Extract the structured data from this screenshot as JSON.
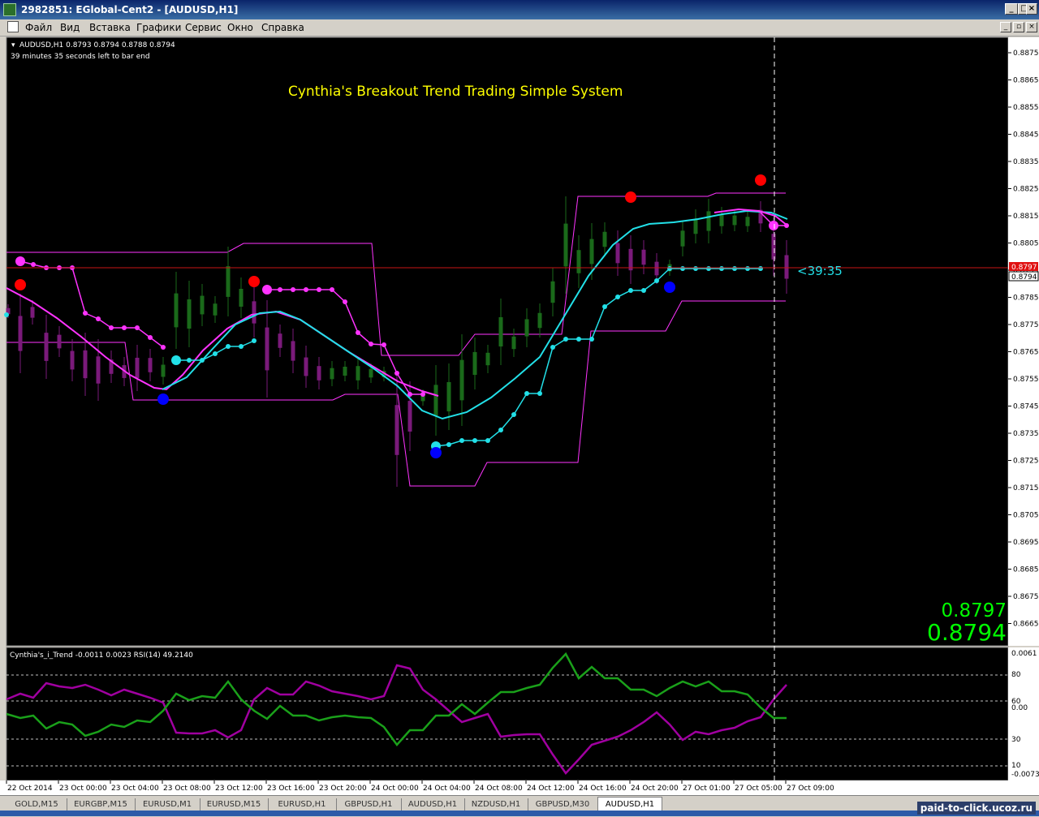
{
  "window": {
    "title": "2982851: EGlobal-Cent2 - [AUDUSD,H1]"
  },
  "menu": [
    "Файл",
    "Вид",
    "Вставка",
    "Графики",
    "Сервис",
    "Окно",
    "Справка"
  ],
  "chart": {
    "header": "AUDUSD,H1  0.8793 0.8794 0.8788 0.8794",
    "timer_text": "39 minutes 35 seconds left to bar end",
    "system_title": "Cynthia's Breakout Trend Trading Simple System",
    "countdown": "<39:35",
    "ask_tag": "0.8797",
    "bid_tag": "0.8794",
    "big_ask": "0.8797",
    "big_bid": "0.8794",
    "indicator_label": "Cynthia's_i_Trend -0.0011 0.0023  RSI(14) 49.2140",
    "price_scale": [
      "0.8875",
      "0.8865",
      "0.8855",
      "0.8845",
      "0.8835",
      "0.8825",
      "0.8815",
      "0.8805",
      "0.8795",
      "0.8785",
      "0.8775",
      "0.8765",
      "0.8755",
      "0.8745",
      "0.8735",
      "0.8725",
      "0.8715",
      "0.8705",
      "0.8695",
      "0.8685",
      "0.8675",
      "0.8665"
    ],
    "indicator_scale": [
      "0.0061",
      "80",
      "60",
      "0.00",
      "30",
      "10",
      "-0.0073"
    ],
    "time_labels": [
      "22 Oct 2014",
      "23 Oct 00:00",
      "23 Oct 04:00",
      "23 Oct 08:00",
      "23 Oct 12:00",
      "23 Oct 16:00",
      "23 Oct 20:00",
      "24 Oct 00:00",
      "24 Oct 04:00",
      "24 Oct 08:00",
      "24 Oct 12:00",
      "24 Oct 16:00",
      "24 Oct 20:00",
      "27 Oct 01:00",
      "27 Oct 05:00",
      "27 Oct 09:00"
    ],
    "colors": {
      "background": "#000000",
      "bull": "#1a6a1a",
      "bear": "#7a1a7a",
      "cyan": "#22e0e8",
      "magenta": "#ff33ff",
      "red_dot": "#ff0000",
      "blue_dot": "#0000ff",
      "title": "#ffff00",
      "big_price": "#00ff00",
      "rsi": "#a000a0",
      "trend": "#1aa01a"
    }
  },
  "tabs": [
    "GOLD,M15",
    "EURGBP,M15",
    "EURUSD,M1",
    "EURUSD,M15",
    "EURUSD,H1",
    "GBPUSD,H1",
    "AUDUSD,H1",
    "NZDUSD,H1",
    "GBPUSD,M30",
    "AUDUSD,H1"
  ],
  "watermark": "paid-to-click.ucoz.ru"
}
